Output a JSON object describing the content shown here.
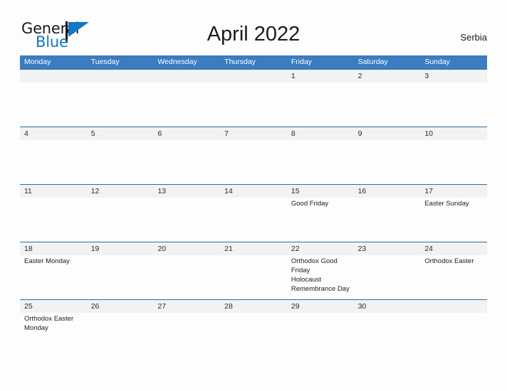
{
  "brand": {
    "word_one": "General",
    "word_two": "Blue",
    "mark_icon": "flag-sail-icon",
    "accent_color": "#1277c4"
  },
  "header": {
    "title": "April 2022",
    "country": "Serbia"
  },
  "theme": {
    "header_bar_color": "#3b7dc0",
    "row_band_color": "#f2f2f2",
    "row_divider_color": "#2e6da4",
    "page_background": "#fdfdfd",
    "text_color": "#1c1c1c"
  },
  "calendar": {
    "weekdays": [
      "Monday",
      "Tuesday",
      "Wednesday",
      "Thursday",
      "Friday",
      "Saturday",
      "Sunday"
    ],
    "weeks": [
      [
        {
          "date": "",
          "events": []
        },
        {
          "date": "",
          "events": []
        },
        {
          "date": "",
          "events": []
        },
        {
          "date": "",
          "events": []
        },
        {
          "date": "1",
          "events": []
        },
        {
          "date": "2",
          "events": []
        },
        {
          "date": "3",
          "events": []
        }
      ],
      [
        {
          "date": "4",
          "events": []
        },
        {
          "date": "5",
          "events": []
        },
        {
          "date": "6",
          "events": []
        },
        {
          "date": "7",
          "events": []
        },
        {
          "date": "8",
          "events": []
        },
        {
          "date": "9",
          "events": []
        },
        {
          "date": "10",
          "events": []
        }
      ],
      [
        {
          "date": "11",
          "events": []
        },
        {
          "date": "12",
          "events": []
        },
        {
          "date": "13",
          "events": []
        },
        {
          "date": "14",
          "events": []
        },
        {
          "date": "15",
          "events": [
            "Good Friday"
          ]
        },
        {
          "date": "16",
          "events": []
        },
        {
          "date": "17",
          "events": [
            "Easter Sunday"
          ]
        }
      ],
      [
        {
          "date": "18",
          "events": [
            "Easter Monday"
          ]
        },
        {
          "date": "19",
          "events": []
        },
        {
          "date": "20",
          "events": []
        },
        {
          "date": "21",
          "events": []
        },
        {
          "date": "22",
          "events": [
            "Orthodox Good Friday",
            " Holocaust Remembrance Day"
          ]
        },
        {
          "date": "23",
          "events": []
        },
        {
          "date": "24",
          "events": [
            "Orthodox Easter"
          ]
        }
      ],
      [
        {
          "date": "25",
          "events": [
            "Orthodox Easter Monday"
          ]
        },
        {
          "date": "26",
          "events": []
        },
        {
          "date": "27",
          "events": []
        },
        {
          "date": "28",
          "events": []
        },
        {
          "date": "29",
          "events": []
        },
        {
          "date": "30",
          "events": []
        },
        {
          "date": "",
          "events": []
        }
      ]
    ]
  }
}
